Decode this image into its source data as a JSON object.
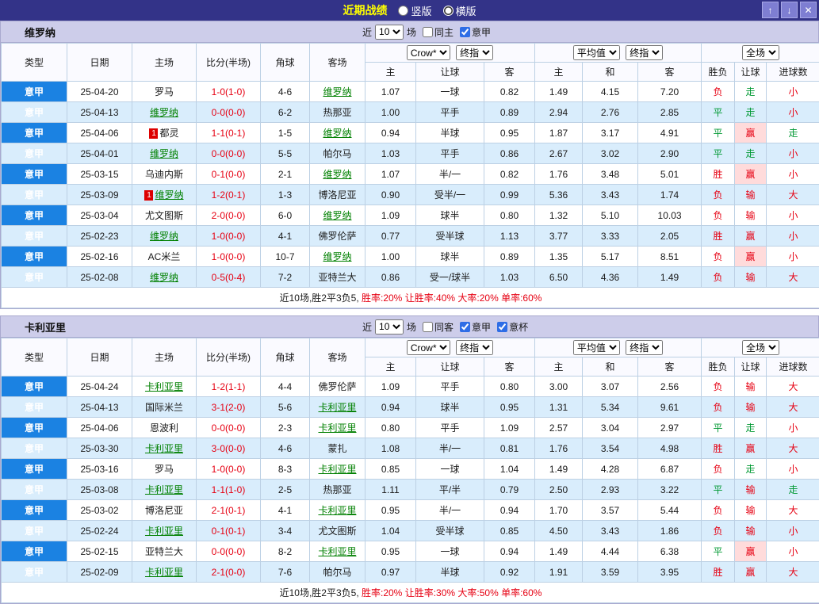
{
  "colors": {
    "titlebar_bg": "#333388",
    "title_text": "#ffff00",
    "band_bg": "#cdcdea",
    "league_cell_bg": "#1b82e2",
    "row_alt_bg": "#d9edfc",
    "focus_team_green": "#008000",
    "score_red": "#e60012",
    "outcome_red": "#e60012",
    "outcome_green": "#009933",
    "win_highlight_bg": "#ffdbdb"
  },
  "titlebar": {
    "title": "近期战绩",
    "radios": [
      {
        "label": "竖版",
        "selected": false
      },
      {
        "label": "横版",
        "selected": true
      }
    ],
    "window_buttons": [
      {
        "name": "scroll-up",
        "glyph": "↑"
      },
      {
        "name": "scroll-down",
        "glyph": "↓"
      },
      {
        "name": "close",
        "glyph": "✕"
      }
    ]
  },
  "header_labels": {
    "left_columns": [
      "类型",
      "日期",
      "主场",
      "比分(半场)",
      "角球",
      "客场"
    ],
    "sub_columns": [
      "主",
      "让球",
      "客",
      "主",
      "和",
      "客",
      "胜负",
      "让球",
      "进球数"
    ]
  },
  "tables": [
    {
      "team": "维罗纳",
      "filter": {
        "near_label": "近",
        "count_value": "10",
        "games_label": "场",
        "checkboxes": [
          {
            "label": "同主",
            "checked": false
          },
          {
            "label": "意甲",
            "checked": true
          }
        ]
      },
      "selects": {
        "group1": [
          "Crow*",
          "终指"
        ],
        "group2": [
          "平均值",
          "终指"
        ],
        "group3": [
          "全场"
        ]
      },
      "rows": [
        {
          "league": "意甲",
          "date": "25-04-20",
          "home": "罗马",
          "home_focus": false,
          "home_badge": "",
          "score": "1-0(1-0)",
          "corners": "4-6",
          "away": "维罗纳",
          "away_focus": true,
          "odds": [
            "1.07",
            "一球",
            "0.82",
            "1.49",
            "4.15",
            "7.20"
          ],
          "outcomes": [
            "负",
            "走",
            "小"
          ]
        },
        {
          "league": "意甲",
          "date": "25-04-13",
          "home": "维罗纳",
          "home_focus": true,
          "home_badge": "",
          "score": "0-0(0-0)",
          "corners": "6-2",
          "away": "热那亚",
          "away_focus": false,
          "odds": [
            "1.00",
            "平手",
            "0.89",
            "2.94",
            "2.76",
            "2.85"
          ],
          "outcomes": [
            "平",
            "走",
            "小"
          ]
        },
        {
          "league": "意甲",
          "date": "25-04-06",
          "home": "都灵",
          "home_focus": false,
          "home_badge": "1",
          "score": "1-1(0-1)",
          "corners": "1-5",
          "away": "维罗纳",
          "away_focus": true,
          "odds": [
            "0.94",
            "半球",
            "0.95",
            "1.87",
            "3.17",
            "4.91"
          ],
          "outcomes": [
            "平",
            "赢",
            "走"
          ]
        },
        {
          "league": "意甲",
          "date": "25-04-01",
          "home": "维罗纳",
          "home_focus": true,
          "home_badge": "",
          "score": "0-0(0-0)",
          "corners": "5-5",
          "away": "帕尔马",
          "away_focus": false,
          "odds": [
            "1.03",
            "平手",
            "0.86",
            "2.67",
            "3.02",
            "2.90"
          ],
          "outcomes": [
            "平",
            "走",
            "小"
          ]
        },
        {
          "league": "意甲",
          "date": "25-03-15",
          "home": "乌迪内斯",
          "home_focus": false,
          "home_badge": "",
          "score": "0-1(0-0)",
          "corners": "2-1",
          "away": "维罗纳",
          "away_focus": true,
          "odds": [
            "1.07",
            "半/一",
            "0.82",
            "1.76",
            "3.48",
            "5.01"
          ],
          "outcomes": [
            "胜",
            "赢",
            "小"
          ]
        },
        {
          "league": "意甲",
          "date": "25-03-09",
          "home": "维罗纳",
          "home_focus": true,
          "home_badge": "1",
          "score": "1-2(0-1)",
          "corners": "1-3",
          "away": "博洛尼亚",
          "away_focus": false,
          "odds": [
            "0.90",
            "受半/一",
            "0.99",
            "5.36",
            "3.43",
            "1.74"
          ],
          "outcomes": [
            "负",
            "输",
            "大"
          ]
        },
        {
          "league": "意甲",
          "date": "25-03-04",
          "home": "尤文图斯",
          "home_focus": false,
          "home_badge": "",
          "score": "2-0(0-0)",
          "corners": "6-0",
          "away": "维罗纳",
          "away_focus": true,
          "odds": [
            "1.09",
            "球半",
            "0.80",
            "1.32",
            "5.10",
            "10.03"
          ],
          "outcomes": [
            "负",
            "输",
            "小"
          ]
        },
        {
          "league": "意甲",
          "date": "25-02-23",
          "home": "维罗纳",
          "home_focus": true,
          "home_badge": "",
          "score": "1-0(0-0)",
          "corners": "4-1",
          "away": "佛罗伦萨",
          "away_focus": false,
          "odds": [
            "0.77",
            "受半球",
            "1.13",
            "3.77",
            "3.33",
            "2.05"
          ],
          "outcomes": [
            "胜",
            "赢",
            "小"
          ]
        },
        {
          "league": "意甲",
          "date": "25-02-16",
          "home": "AC米兰",
          "home_focus": false,
          "home_badge": "",
          "score": "1-0(0-0)",
          "corners": "10-7",
          "away": "维罗纳",
          "away_focus": true,
          "odds": [
            "1.00",
            "球半",
            "0.89",
            "1.35",
            "5.17",
            "8.51"
          ],
          "outcomes": [
            "负",
            "赢",
            "小"
          ]
        },
        {
          "league": "意甲",
          "date": "25-02-08",
          "home": "维罗纳",
          "home_focus": true,
          "home_badge": "",
          "score": "0-5(0-4)",
          "corners": "7-2",
          "away": "亚特兰大",
          "away_focus": false,
          "odds": [
            "0.86",
            "受一/球半",
            "1.03",
            "6.50",
            "4.36",
            "1.49"
          ],
          "outcomes": [
            "负",
            "输",
            "大"
          ]
        }
      ],
      "summary": [
        {
          "text": "近10场,胜2平3负5, ",
          "red": false
        },
        {
          "text": "胜率:20%",
          "red": true
        },
        {
          "text": " 让胜率:40%",
          "red": true
        },
        {
          "text": " 大率:20%",
          "red": true
        },
        {
          "text": " 单率:60%",
          "red": true
        }
      ]
    },
    {
      "team": "卡利亚里",
      "filter": {
        "near_label": "近",
        "count_value": "10",
        "games_label": "场",
        "checkboxes": [
          {
            "label": "同客",
            "checked": false
          },
          {
            "label": "意甲",
            "checked": true
          },
          {
            "label": "意杯",
            "checked": true
          }
        ]
      },
      "selects": {
        "group1": [
          "Crow*",
          "终指"
        ],
        "group2": [
          "平均值",
          "终指"
        ],
        "group3": [
          "全场"
        ]
      },
      "rows": [
        {
          "league": "意甲",
          "date": "25-04-24",
          "home": "卡利亚里",
          "home_focus": true,
          "home_badge": "",
          "score": "1-2(1-1)",
          "corners": "4-4",
          "away": "佛罗伦萨",
          "away_focus": false,
          "odds": [
            "1.09",
            "平手",
            "0.80",
            "3.00",
            "3.07",
            "2.56"
          ],
          "outcomes": [
            "负",
            "输",
            "大"
          ]
        },
        {
          "league": "意甲",
          "date": "25-04-13",
          "home": "国际米兰",
          "home_focus": false,
          "home_badge": "",
          "score": "3-1(2-0)",
          "corners": "5-6",
          "away": "卡利亚里",
          "away_focus": true,
          "odds": [
            "0.94",
            "球半",
            "0.95",
            "1.31",
            "5.34",
            "9.61"
          ],
          "outcomes": [
            "负",
            "输",
            "大"
          ]
        },
        {
          "league": "意甲",
          "date": "25-04-06",
          "home": "恩波利",
          "home_focus": false,
          "home_badge": "",
          "score": "0-0(0-0)",
          "corners": "2-3",
          "away": "卡利亚里",
          "away_focus": true,
          "odds": [
            "0.80",
            "平手",
            "1.09",
            "2.57",
            "3.04",
            "2.97"
          ],
          "outcomes": [
            "平",
            "走",
            "小"
          ]
        },
        {
          "league": "意甲",
          "date": "25-03-30",
          "home": "卡利亚里",
          "home_focus": true,
          "home_badge": "",
          "score": "3-0(0-0)",
          "corners": "4-6",
          "away": "蒙扎",
          "away_focus": false,
          "odds": [
            "1.08",
            "半/一",
            "0.81",
            "1.76",
            "3.54",
            "4.98"
          ],
          "outcomes": [
            "胜",
            "赢",
            "大"
          ]
        },
        {
          "league": "意甲",
          "date": "25-03-16",
          "home": "罗马",
          "home_focus": false,
          "home_badge": "",
          "score": "1-0(0-0)",
          "corners": "8-3",
          "away": "卡利亚里",
          "away_focus": true,
          "odds": [
            "0.85",
            "一球",
            "1.04",
            "1.49",
            "4.28",
            "6.87"
          ],
          "outcomes": [
            "负",
            "走",
            "小"
          ]
        },
        {
          "league": "意甲",
          "date": "25-03-08",
          "home": "卡利亚里",
          "home_focus": true,
          "home_badge": "",
          "score": "1-1(1-0)",
          "corners": "2-5",
          "away": "热那亚",
          "away_focus": false,
          "odds": [
            "1.11",
            "平/半",
            "0.79",
            "2.50",
            "2.93",
            "3.22"
          ],
          "outcomes": [
            "平",
            "输",
            "走"
          ]
        },
        {
          "league": "意甲",
          "date": "25-03-02",
          "home": "博洛尼亚",
          "home_focus": false,
          "home_badge": "",
          "score": "2-1(0-1)",
          "corners": "4-1",
          "away": "卡利亚里",
          "away_focus": true,
          "odds": [
            "0.95",
            "半/一",
            "0.94",
            "1.70",
            "3.57",
            "5.44"
          ],
          "outcomes": [
            "负",
            "输",
            "大"
          ]
        },
        {
          "league": "意甲",
          "date": "25-02-24",
          "home": "卡利亚里",
          "home_focus": true,
          "home_badge": "",
          "score": "0-1(0-1)",
          "corners": "3-4",
          "away": "尤文图斯",
          "away_focus": false,
          "odds": [
            "1.04",
            "受半球",
            "0.85",
            "4.50",
            "3.43",
            "1.86"
          ],
          "outcomes": [
            "负",
            "输",
            "小"
          ]
        },
        {
          "league": "意甲",
          "date": "25-02-15",
          "home": "亚特兰大",
          "home_focus": false,
          "home_badge": "",
          "score": "0-0(0-0)",
          "corners": "8-2",
          "away": "卡利亚里",
          "away_focus": true,
          "odds": [
            "0.95",
            "一球",
            "0.94",
            "1.49",
            "4.44",
            "6.38"
          ],
          "outcomes": [
            "平",
            "赢",
            "小"
          ]
        },
        {
          "league": "意甲",
          "date": "25-02-09",
          "home": "卡利亚里",
          "home_focus": true,
          "home_badge": "",
          "score": "2-1(0-0)",
          "corners": "7-6",
          "away": "帕尔马",
          "away_focus": false,
          "odds": [
            "0.97",
            "半球",
            "0.92",
            "1.91",
            "3.59",
            "3.95"
          ],
          "outcomes": [
            "胜",
            "赢",
            "大"
          ]
        }
      ],
      "summary": [
        {
          "text": "近10场,胜2平3负5, ",
          "red": false
        },
        {
          "text": "胜率:20%",
          "red": true
        },
        {
          "text": " 让胜率:30%",
          "red": true
        },
        {
          "text": " 大率:50%",
          "red": true
        },
        {
          "text": " 单率:60%",
          "red": true
        }
      ]
    }
  ]
}
